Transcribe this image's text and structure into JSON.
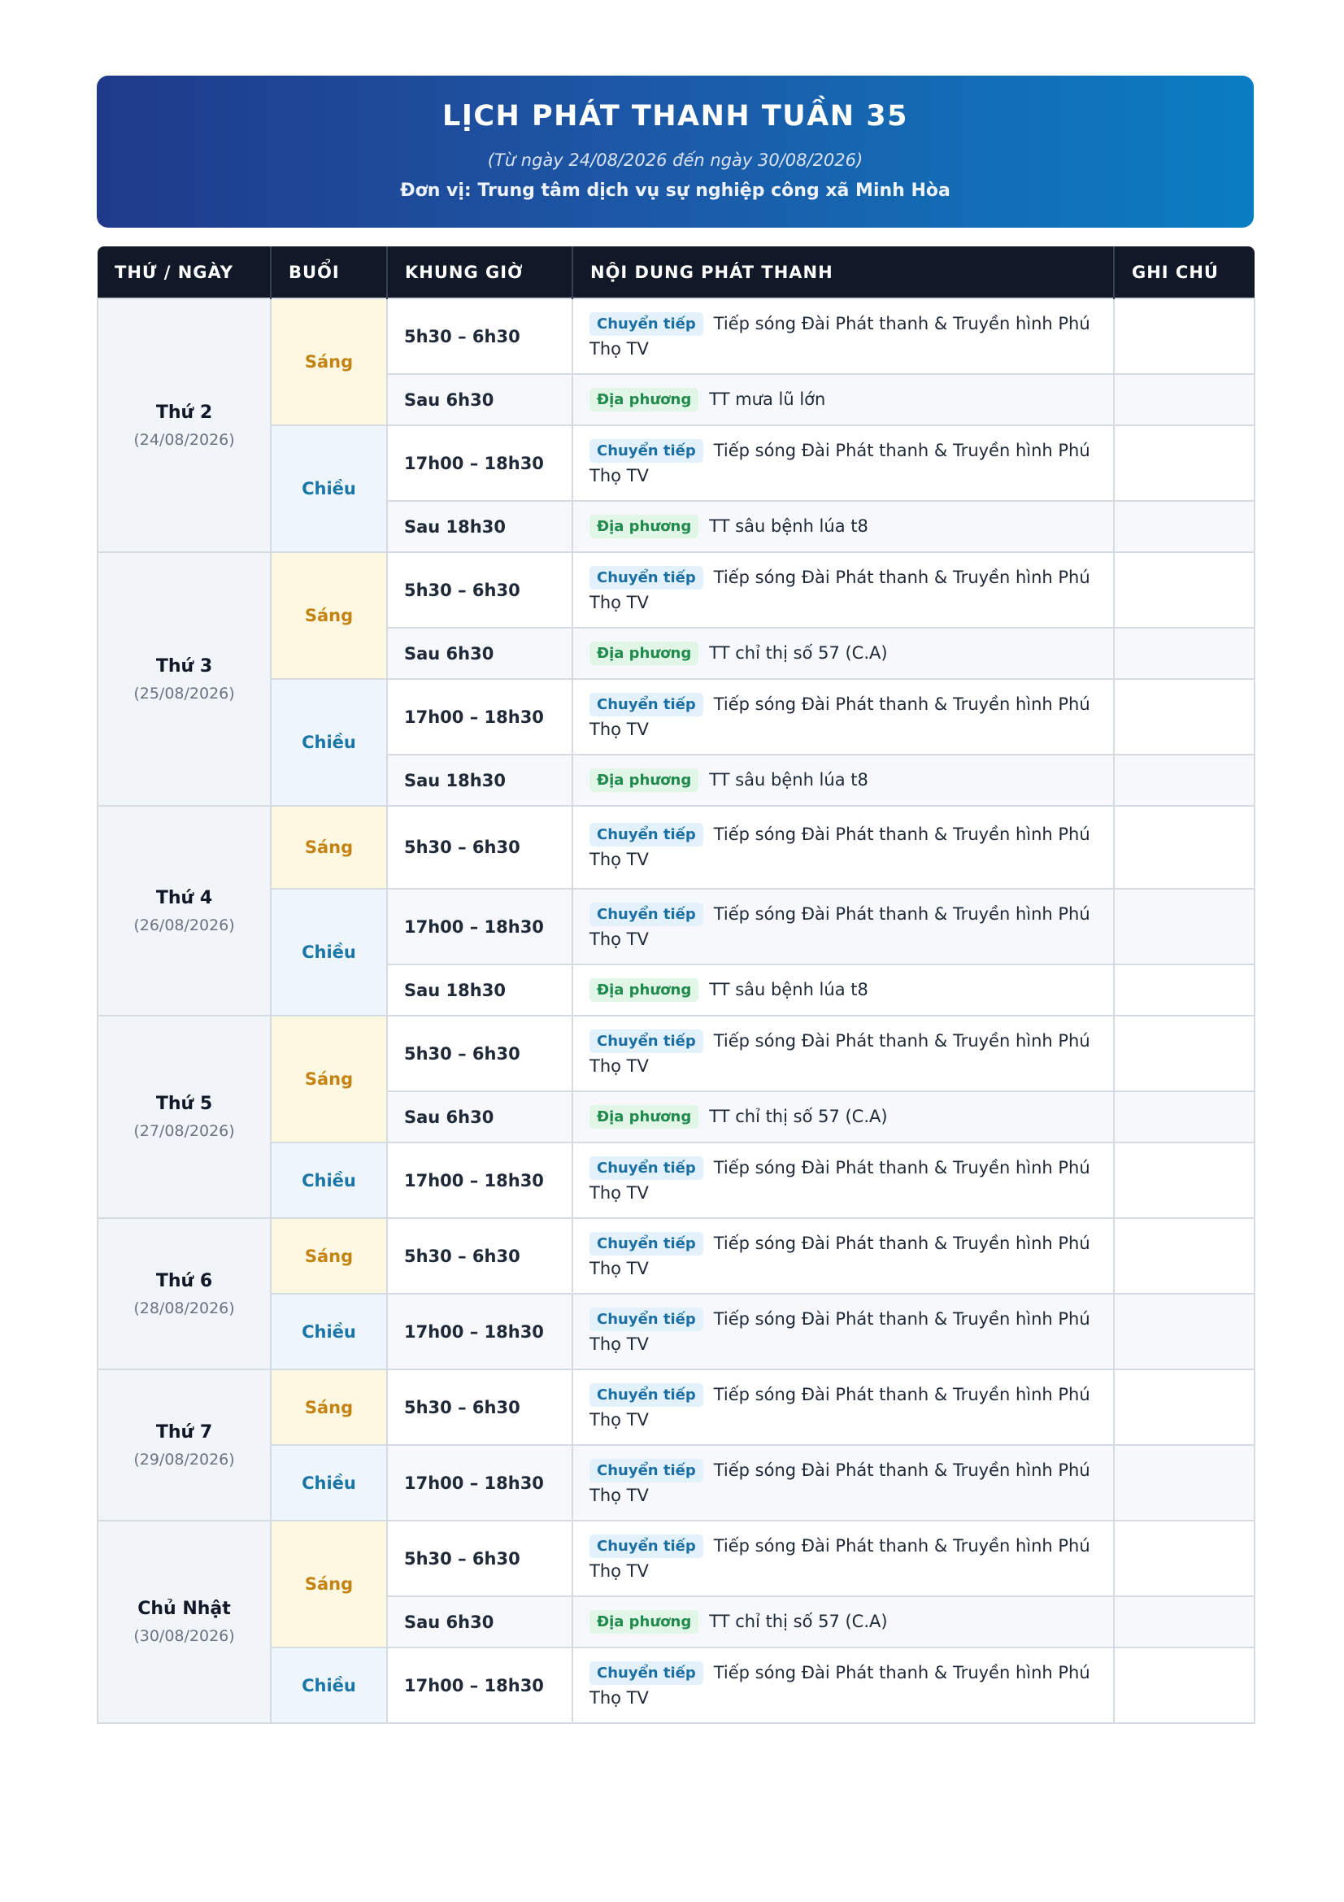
{
  "header": {
    "title": "LỊCH PHÁT THANH TUẦN 35",
    "subtitle": "(Từ ngày 24/08/2026 đến ngày 30/08/2026)",
    "unit": "Đơn vị: Trung tâm dịch vụ sự nghiệp công xã Minh Hòa"
  },
  "table": {
    "columns": [
      "THỨ / NGÀY",
      "BUỔI",
      "KHUNG GIỜ",
      "NỘI DUNG PHÁT THANH",
      "GHI CHÚ"
    ],
    "days": [
      {
        "name": "Thứ 2",
        "date": "(24/08/2026)",
        "sessions": [
          {
            "label": "Sáng",
            "kind": "sang",
            "slots": [
              {
                "time": "5h30 – 6h30",
                "badge": "Chuyển tiếp",
                "badge_kind": "relay",
                "content": "Tiếp sóng Đài Phát thanh & Truyền hình Phú Thọ TV",
                "note": "",
                "h": 93
              },
              {
                "time": "Sau 6h30",
                "badge": "Địa phương",
                "badge_kind": "local",
                "content": "TT mưa lũ lớn",
                "note": "",
                "h": 63
              }
            ]
          },
          {
            "label": "Chiều",
            "kind": "chieu",
            "slots": [
              {
                "time": "17h00 – 18h30",
                "badge": "Chuyển tiếp",
                "badge_kind": "relay",
                "content": "Tiếp sóng Đài Phát thanh & Truyền hình Phú Thọ TV",
                "note": "",
                "h": 93
              },
              {
                "time": "Sau 18h30",
                "badge": "Địa phương",
                "badge_kind": "local",
                "content": "TT sâu bệnh lúa t8",
                "note": "",
                "h": 63
              }
            ]
          }
        ]
      },
      {
        "name": "Thứ 3",
        "date": "(25/08/2026)",
        "sessions": [
          {
            "label": "Sáng",
            "kind": "sang",
            "slots": [
              {
                "time": "5h30 – 6h30",
                "badge": "Chuyển tiếp",
                "badge_kind": "relay",
                "content": "Tiếp sóng Đài Phát thanh & Truyền hình Phú Thọ TV",
                "note": "",
                "h": 93
              },
              {
                "time": "Sau 6h30",
                "badge": "Địa phương",
                "badge_kind": "local",
                "content": "TT chỉ thị số 57 (C.A)",
                "note": "",
                "h": 63
              }
            ]
          },
          {
            "label": "Chiều",
            "kind": "chieu",
            "slots": [
              {
                "time": "17h00 – 18h30",
                "badge": "Chuyển tiếp",
                "badge_kind": "relay",
                "content": "Tiếp sóng Đài Phát thanh & Truyền hình Phú Thọ TV",
                "note": "",
                "h": 93
              },
              {
                "time": "Sau 18h30",
                "badge": "Địa phương",
                "badge_kind": "local",
                "content": "TT sâu bệnh lúa t8",
                "note": "",
                "h": 63
              }
            ]
          }
        ]
      },
      {
        "name": "Thứ 4",
        "date": "(26/08/2026)",
        "sessions": [
          {
            "label": "Sáng",
            "kind": "sang",
            "slots": [
              {
                "time": "5h30 – 6h30",
                "badge": "Chuyển tiếp",
                "badge_kind": "relay",
                "content": "Tiếp sóng Đài Phát thanh & Truyền hình Phú Thọ TV",
                "note": "",
                "h": 102
              }
            ]
          },
          {
            "label": "Chiều",
            "kind": "chieu",
            "slots": [
              {
                "time": "17h00 – 18h30",
                "badge": "Chuyển tiếp",
                "badge_kind": "relay",
                "content": "Tiếp sóng Đài Phát thanh & Truyền hình Phú Thọ TV",
                "note": "",
                "h": 93
              },
              {
                "time": "Sau 18h30",
                "badge": "Địa phương",
                "badge_kind": "local",
                "content": "TT sâu bệnh lúa t8",
                "note": "",
                "h": 63
              }
            ]
          }
        ]
      },
      {
        "name": "Thứ 5",
        "date": "(27/08/2026)",
        "sessions": [
          {
            "label": "Sáng",
            "kind": "sang",
            "slots": [
              {
                "time": "5h30 – 6h30",
                "badge": "Chuyển tiếp",
                "badge_kind": "relay",
                "content": "Tiếp sóng Đài Phát thanh & Truyền hình Phú Thọ TV",
                "note": "",
                "h": 93
              },
              {
                "time": "Sau 6h30",
                "badge": "Địa phương",
                "badge_kind": "local",
                "content": "TT chỉ thị số 57 (C.A)",
                "note": "",
                "h": 63
              }
            ]
          },
          {
            "label": "Chiều",
            "kind": "chieu",
            "slots": [
              {
                "time": "17h00 – 18h30",
                "badge": "Chuyển tiếp",
                "badge_kind": "relay",
                "content": "Tiếp sóng Đài Phát thanh & Truyền hình Phú Thọ TV",
                "note": "",
                "h": 93
              }
            ]
          }
        ]
      },
      {
        "name": "Thứ 6",
        "date": "(28/08/2026)",
        "sessions": [
          {
            "label": "Sáng",
            "kind": "sang",
            "slots": [
              {
                "time": "5h30 – 6h30",
                "badge": "Chuyển tiếp",
                "badge_kind": "relay",
                "content": "Tiếp sóng Đài Phát thanh & Truyền hình Phú Thọ TV",
                "note": "",
                "h": 93
              }
            ]
          },
          {
            "label": "Chiều",
            "kind": "chieu",
            "slots": [
              {
                "time": "17h00 – 18h30",
                "badge": "Chuyển tiếp",
                "badge_kind": "relay",
                "content": "Tiếp sóng Đài Phát thanh & Truyền hình Phú Thọ TV",
                "note": "",
                "h": 93
              }
            ]
          }
        ]
      },
      {
        "name": "Thứ 7",
        "date": "(29/08/2026)",
        "sessions": [
          {
            "label": "Sáng",
            "kind": "sang",
            "slots": [
              {
                "time": "5h30 – 6h30",
                "badge": "Chuyển tiếp",
                "badge_kind": "relay",
                "content": "Tiếp sóng Đài Phát thanh & Truyền hình Phú Thọ TV",
                "note": "",
                "h": 93
              }
            ]
          },
          {
            "label": "Chiều",
            "kind": "chieu",
            "slots": [
              {
                "time": "17h00 – 18h30",
                "badge": "Chuyển tiếp",
                "badge_kind": "relay",
                "content": "Tiếp sóng Đài Phát thanh & Truyền hình Phú Thọ TV",
                "note": "",
                "h": 93
              }
            ]
          }
        ]
      },
      {
        "name": "Chủ Nhật",
        "date": "(30/08/2026)",
        "sessions": [
          {
            "label": "Sáng",
            "kind": "sang",
            "slots": [
              {
                "time": "5h30 – 6h30",
                "badge": "Chuyển tiếp",
                "badge_kind": "relay",
                "content": "Tiếp sóng Đài Phát thanh & Truyền hình Phú Thọ TV",
                "note": "",
                "h": 93
              },
              {
                "time": "Sau 6h30",
                "badge": "Địa phương",
                "badge_kind": "local",
                "content": "TT chỉ thị số 57 (C.A)",
                "note": "",
                "h": 63
              }
            ]
          },
          {
            "label": "Chiều",
            "kind": "chieu",
            "slots": [
              {
                "time": "17h00 – 18h30",
                "badge": "Chuyển tiếp",
                "badge_kind": "relay",
                "content": "Tiếp sóng Đài Phát thanh & Truyền hình Phú Thọ TV",
                "note": "",
                "h": 93
              }
            ]
          }
        ]
      }
    ]
  }
}
